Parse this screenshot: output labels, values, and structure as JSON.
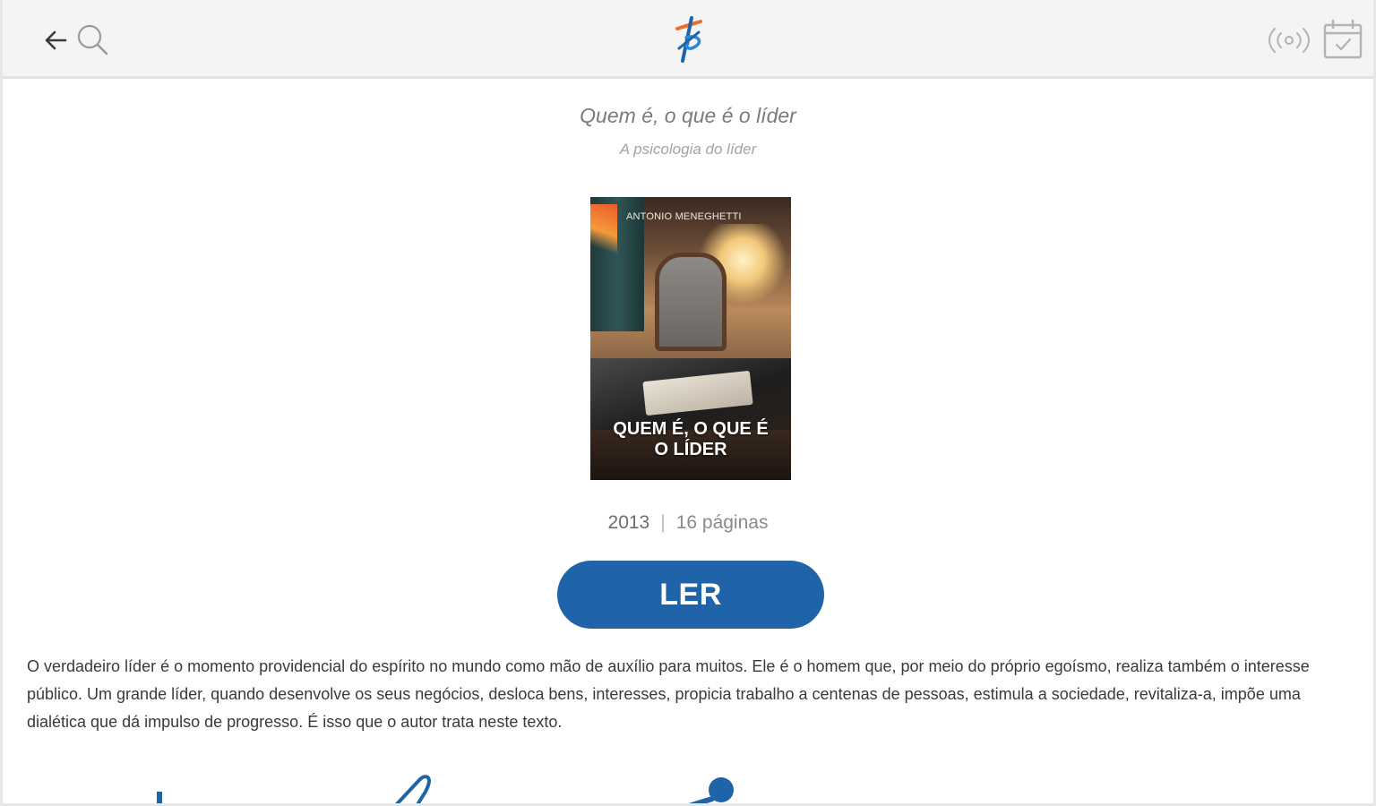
{
  "header": {
    "back_icon": "arrow-left-icon",
    "search_icon": "search-icon",
    "logo_icon": "app-logo-icon",
    "live_icon": "broadcast-icon",
    "calendar_icon": "calendar-check-icon"
  },
  "book": {
    "title": "Quem é, o que é o líder",
    "subtitle": "A psicologia do líder",
    "cover": {
      "author": "ANTONIO MENEGHETTI",
      "title_line1": "QUEM É, O QUE É",
      "title_line2": "O LÍDER"
    },
    "year": "2013",
    "separator": "|",
    "pages": "16 páginas",
    "read_label": "LER",
    "description": "O verdadeiro líder é o momento providencial do espírito no mundo como mão de auxílio para muitos. Ele é o homem que, por meio do próprio egoísmo, realiza também o interesse público. Um grande líder, quando desenvolve os seus negócios, desloca bens, interesses, propicia trabalho a centenas de pessoas, estimula a sociedade, revitaliza-a, impõe uma dialética que dá impulso de progresso. É isso que o autor trata neste texto."
  },
  "colors": {
    "accent": "#1f64a8",
    "topbar": "#f4f4f4",
    "text": "#3a3a3a",
    "muted": "#7b7b7b"
  },
  "bottom_icons": [
    "download-icon",
    "pen-icon",
    "microphone-icon"
  ]
}
